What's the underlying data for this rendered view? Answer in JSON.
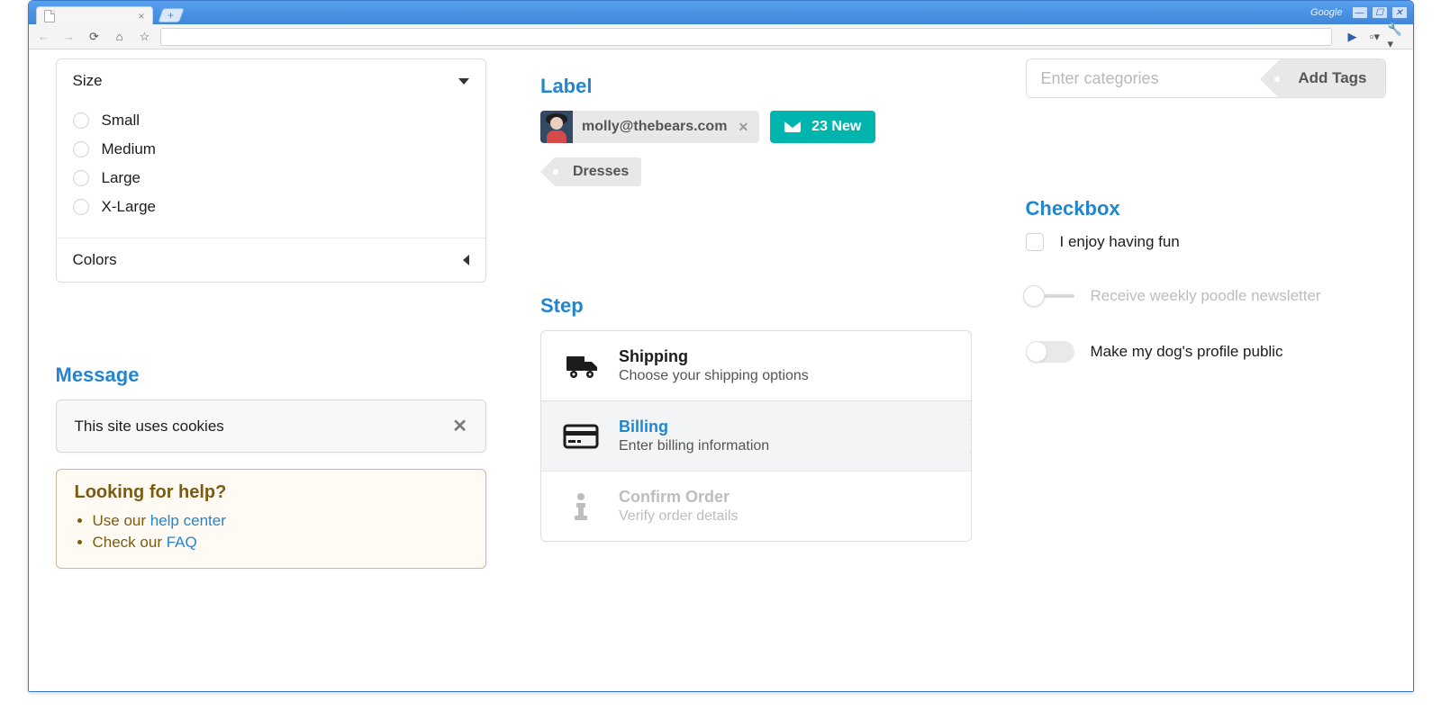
{
  "chrome": {
    "brand": "Google",
    "win_min": "—",
    "win_max": "☐",
    "win_close": "✕"
  },
  "accordion": {
    "size_title": "Size",
    "options": [
      "Small",
      "Medium",
      "Large",
      "X-Large"
    ],
    "colors_title": "Colors"
  },
  "message_section": {
    "heading": "Message",
    "cookie_text": "This site uses cookies",
    "help_heading": "Looking for help?",
    "help_line1_pre": "Use our ",
    "help_line1_link": "help center",
    "help_line2_pre": "Check our ",
    "help_line2_link": "FAQ"
  },
  "label_section": {
    "heading": "Label",
    "email": "molly@thebears.com",
    "new_count": "23 New",
    "tag": "Dresses"
  },
  "step_section": {
    "heading": "Step",
    "steps": [
      {
        "title": "Shipping",
        "desc": "Choose your shipping options"
      },
      {
        "title": "Billing",
        "desc": "Enter billing information"
      },
      {
        "title": "Confirm Order",
        "desc": "Verify order details"
      }
    ]
  },
  "taginput": {
    "placeholder": "Enter categories",
    "button": "Add Tags"
  },
  "checkbox_section": {
    "heading": "Checkbox",
    "options": [
      "I enjoy having fun",
      "Receive weekly poodle newsletter",
      "Make my dog's profile public"
    ]
  }
}
